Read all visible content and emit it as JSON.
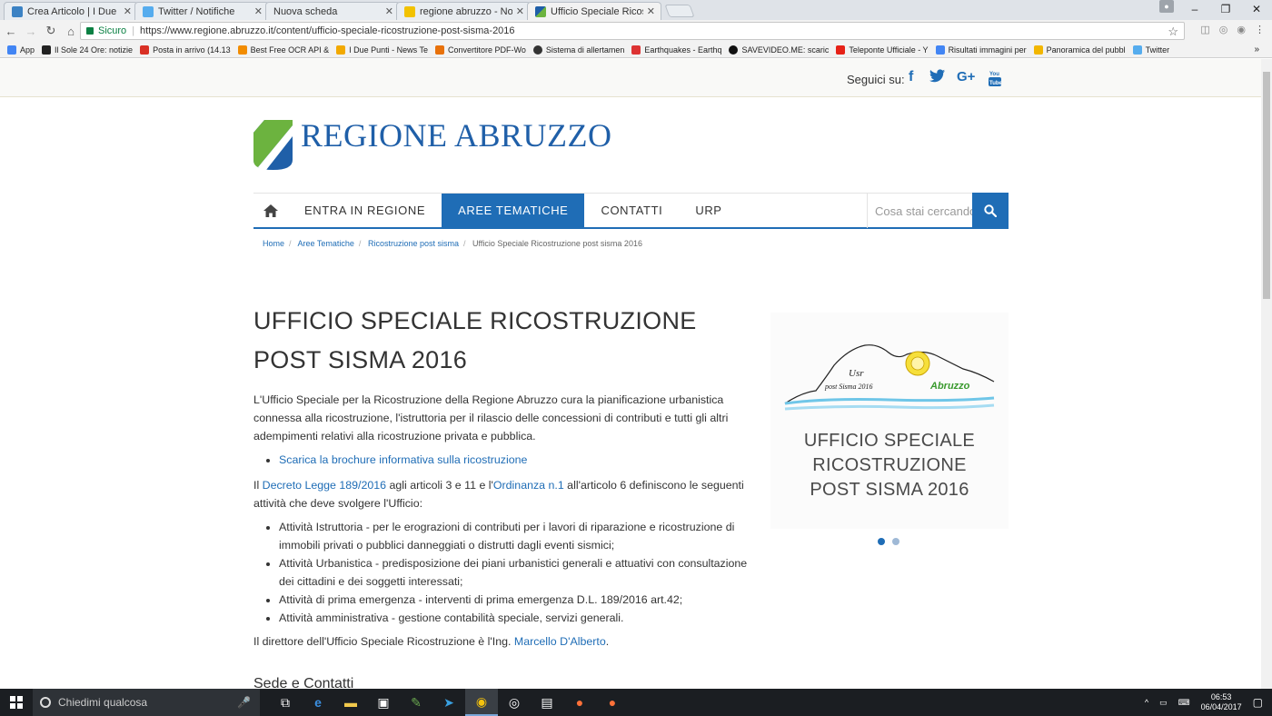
{
  "browser": {
    "tabs": [
      {
        "label": "Crea Articolo | I Due Punt",
        "color": "#3b82c4"
      },
      {
        "label": "Twitter / Notifiche",
        "color": "#55acee"
      },
      {
        "label": "Nuova scheda",
        "color": ""
      },
      {
        "label": "regione abruzzo - Norto",
        "color": "#f2c200"
      },
      {
        "label": "Ufficio Speciale Ricostruz",
        "color": "#4a9a3a"
      }
    ],
    "secure_label": "Sicuro",
    "url": "https://www.regione.abruzzo.it/content/ufficio-speciale-ricostruzione-post-sisma-2016",
    "bookmarks": [
      {
        "label": "App",
        "color": "#4285f4"
      },
      {
        "label": "Il Sole 24 Ore: notizie",
        "color": "#222"
      },
      {
        "label": "Posta in arrivo (14.13",
        "color": "#d93025"
      },
      {
        "label": "Best Free OCR API &",
        "color": "#f28c00"
      },
      {
        "label": "I Due Punti - News Te",
        "color": "#f2a900"
      },
      {
        "label": "Convertitore PDF-Wo",
        "color": "#e8710a"
      },
      {
        "label": "Sistema di allertamen",
        "color": "#333"
      },
      {
        "label": "Earthquakes - Earthq",
        "color": "#d33"
      },
      {
        "label": "SAVEVIDEO.ME: scaric",
        "color": "#111"
      },
      {
        "label": "Teleponte Ufficiale - Y",
        "color": "#e62117"
      },
      {
        "label": "Risultati immagini per",
        "color": "#4285f4"
      },
      {
        "label": "Panoramica del pubbl",
        "color": "#f2b600"
      },
      {
        "label": "Twitter",
        "color": "#55acee"
      }
    ]
  },
  "site": {
    "follow_label": "Seguici su:",
    "social": [
      "f",
      "t",
      "G+",
      "yt"
    ],
    "brand": "REGIONE ABRUZZO",
    "nav": [
      "ENTRA IN REGIONE",
      "AREE TEMATICHE",
      "CONTATTI",
      "URP"
    ],
    "search_placeholder": "Cosa stai cercando",
    "breadcrumb": [
      "Home",
      "Aree Tematiche",
      "Ricostruzione post sisma",
      "Ufficio Speciale Ricostruzione post sisma 2016"
    ]
  },
  "article": {
    "title": "UFFICIO SPECIALE RICOSTRUZIONE POST SISMA 2016",
    "intro": "L'Ufficio Speciale per la Ricostruzione della Regione Abruzzo cura la pianificazione urbanistica connessa alla ricostruzione, l'istruttoria per il rilascio delle concessioni di contributi e tutti gli altri adempimenti relativi alla ricostruzione privata e pubblica.",
    "brochure_link": "Scarica la brochure informativa sulla ricostruzione",
    "p2_a": "Il ",
    "p2_link1": "Decreto Legge 189/2016",
    "p2_b": " agli articoli 3 e 11 e l'",
    "p2_link2": "Ordinanza n.1",
    "p2_c": " all'articolo 6 definiscono le seguenti attività che deve svolgere l'Ufficio:",
    "activities": [
      "Attività Istruttoria - per le erograzioni di contributi per i lavori di riparazione e ricostruzione di immobili privati o pubblici danneggiati o distrutti dagli eventi sismici;",
      "Attività Urbanistica - predisposizione dei piani urbanistici generali e attuativi con consultazione dei cittadini e dei soggetti interessati;",
      "Attività di prima emergenza - interventi di prima emergenza D.L. 189/2016 art.42;",
      "Attività amministrativa - gestione contabilità speciale, servizi generali."
    ],
    "director_text": "Il direttore dell'Ufficio Speciale Ricostruzione è l'Ing. ",
    "director_link": "Marcello D'Alberto",
    "director_end": ".",
    "next_heading": "Sede e Contatti"
  },
  "card": {
    "usr": "Usr",
    "post": "post Sisma 2016",
    "abruzzo": "Abruzzo",
    "line1": "UFFICIO SPECIALE",
    "line2": "RICOSTRUZIONE",
    "line3": "POST SISMA 2016"
  },
  "taskbar": {
    "search_placeholder": "Chiedimi qualcosa",
    "time": "06:53",
    "date": "06/04/2017"
  }
}
